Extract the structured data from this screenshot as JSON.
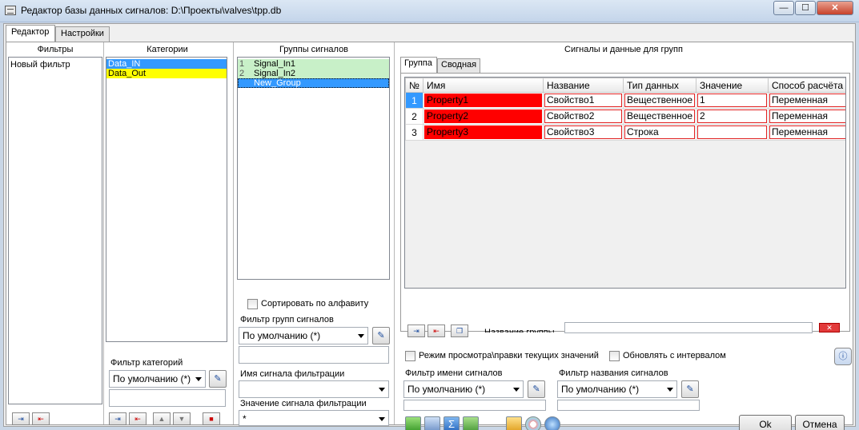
{
  "window": {
    "title": "Редактор базы данных сигналов: D:\\Проекты\\valves\\tpp.db",
    "minimize_glyph": "—",
    "maximize_glyph": "☐",
    "close_glyph": "✕"
  },
  "main_tabs": [
    {
      "label": "Редактор",
      "active": true
    },
    {
      "label": "Настройки",
      "active": false
    }
  ],
  "filters": {
    "header": "Фильтры",
    "items": [
      "Новый фильтр"
    ]
  },
  "categories": {
    "header": "Категории",
    "items": [
      {
        "label": "Data_IN",
        "color": "#3399ff"
      },
      {
        "label": "Data_Out",
        "color": "#ffff00"
      }
    ],
    "filter_label": "Фильтр категорий",
    "filter_value": "По умолчанию (*)"
  },
  "signal_groups": {
    "header": "Группы сигналов",
    "items": [
      {
        "num": "1",
        "label": "Signal_In1",
        "color": "#c8f0c8"
      },
      {
        "num": "2",
        "label": "Signal_In2",
        "color": "#c8f0c8"
      },
      {
        "num": "",
        "label": "New_Group",
        "color": "#3399ff"
      }
    ],
    "sort_label": "Сортировать по алфавиту",
    "group_filter_label": "Фильтр групп сигналов",
    "group_filter_value": "По умолчанию (*)",
    "filter_signal_name_label": "Имя сигнала фильтрации",
    "filter_signal_value_label": "Значение сигнала фильтрации",
    "filter_signal_value": "*"
  },
  "signals": {
    "header": "Сигналы и данные для групп",
    "tabs": [
      {
        "label": "Группа",
        "active": true
      },
      {
        "label": "Сводная",
        "active": false
      }
    ],
    "columns": [
      "№",
      "Имя",
      "Название",
      "Тип данных",
      "Значение",
      "Способ расчёта"
    ],
    "rows": [
      {
        "num": "1",
        "name": "Property1",
        "title": "Свойство1",
        "type": "Вещественное",
        "value": "1",
        "method": "Переменная"
      },
      {
        "num": "2",
        "name": "Property2",
        "title": "Свойство2",
        "type": "Вещественное",
        "value": "2",
        "method": "Переменная"
      },
      {
        "num": "3",
        "name": "Property3",
        "title": "Свойство3",
        "type": "Строка",
        "value": "",
        "method": "Переменная"
      }
    ],
    "group_name_label": "Название группы",
    "view_mode_label": "Режим просмотра\\правки текущих значений",
    "refresh_label": "Обновлять с интервалом",
    "signal_name_filter_label": "Фильтр имени сигналов",
    "signal_name_filter_value": "По умолчанию (*)",
    "signal_title_filter_label": "Фильтр названия сигналов",
    "signal_title_filter_value": "По умолчанию (*)"
  },
  "footer": {
    "ok_label": "Ok",
    "cancel_label": "Отмена"
  },
  "colors": {
    "accent_blue": "#3399ff",
    "error_red": "#ff0000",
    "group_green": "#c8f0c8",
    "category_yellow": "#ffff00"
  }
}
